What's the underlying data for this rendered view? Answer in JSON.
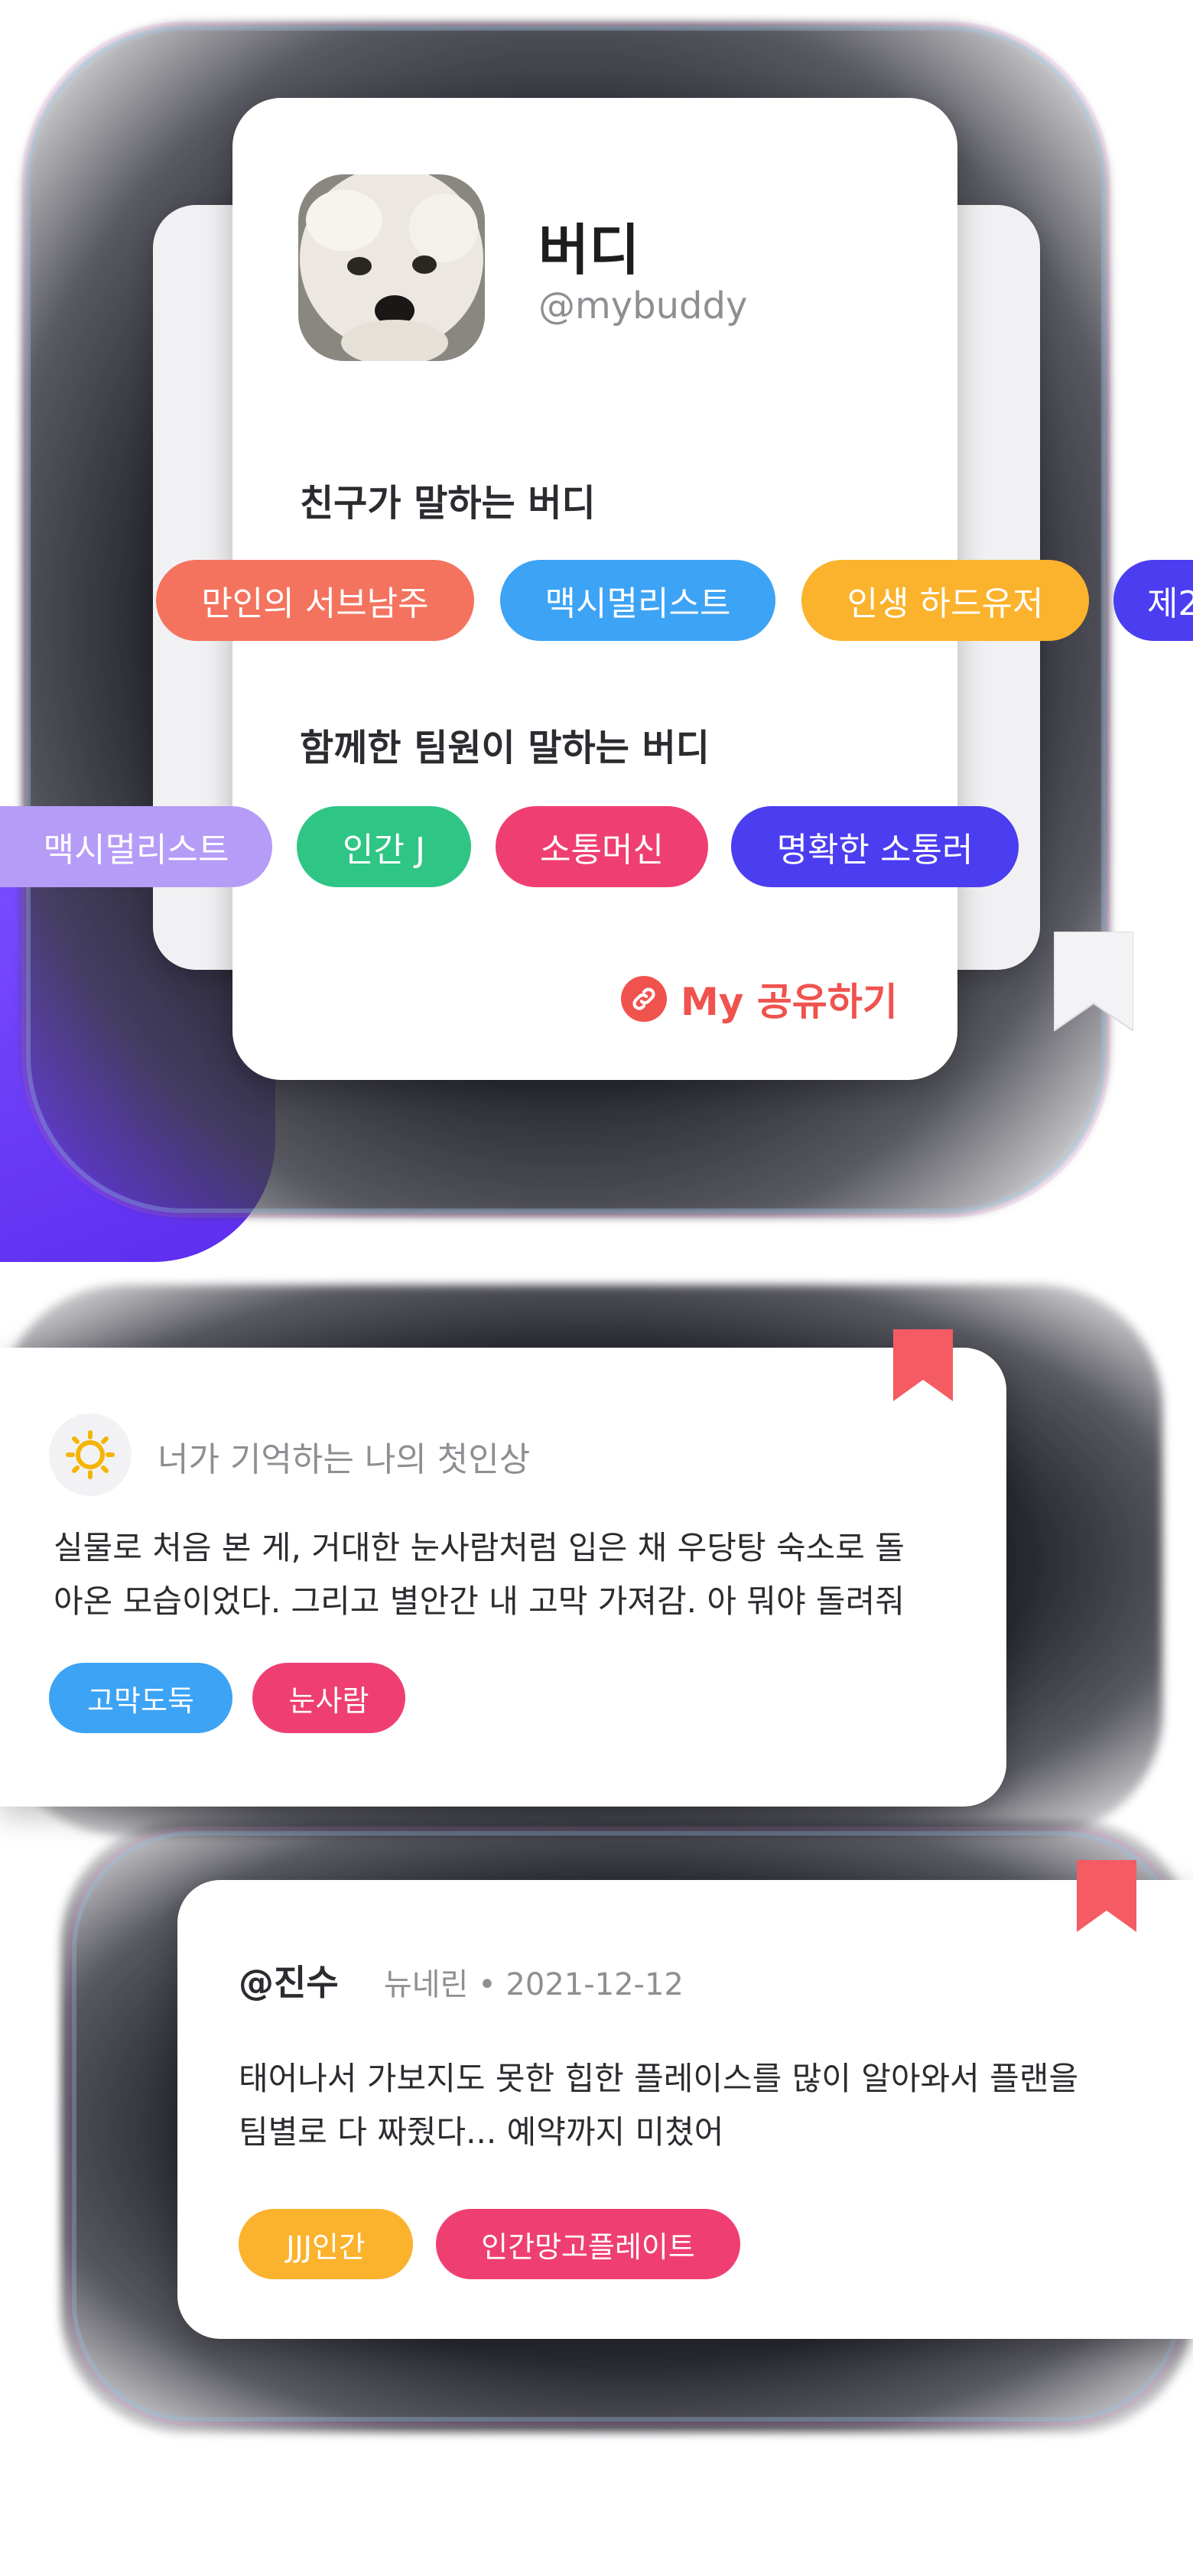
{
  "profile": {
    "name": "버디",
    "handle": "@mybuddy",
    "friends_heading": "친구가 말하는 버디",
    "friends_tags": [
      {
        "label": "만인의 서브남주",
        "color": "#f4735f"
      },
      {
        "label": "맥시멀리스트",
        "color": "#3da3f5"
      },
      {
        "label": "인생 하드유저",
        "color": "#fbb22c"
      },
      {
        "label": "제2",
        "color": "#4b3df0"
      }
    ],
    "team_heading": "함께한 팀원이 말하는 버디",
    "team_tags": [
      {
        "label": "맥시멀리스트",
        "color": "#b59cf7"
      },
      {
        "label": "인간 J",
        "color": "#2fc585"
      },
      {
        "label": "소통머신",
        "color": "#ef3f72"
      },
      {
        "label": "명확한 소통러",
        "color": "#4b3df0"
      }
    ],
    "share_label": "My 공유하기"
  },
  "impression_card": {
    "title": "너가 기억하는 나의 첫인상",
    "text_line1": "실물로 처음 본 게, 거대한 눈사람처럼 입은 채 우당탕 숙소로 돌",
    "text_line2": "아온 모습이었다. 그리고 별안간 내 고막 가져감. 아 뭐야 돌려줘",
    "tags": [
      {
        "label": "고막도둑",
        "color": "#3da3f5"
      },
      {
        "label": "눈사람",
        "color": "#ef3f72"
      }
    ]
  },
  "review_card": {
    "author": "@진수",
    "meta": "뉴네린 • 2021-12-12",
    "text_line1": "태어나서 가보지도 못한 힙한 플레이스를 많이 알아와서 플랜을",
    "text_line2": "팀별로 다 짜줬다... 예약까지 미쳤어",
    "tags": [
      {
        "label": "JJJ인간",
        "color": "#fbb22c"
      },
      {
        "label": "인간망고플레이트",
        "color": "#ef3f72"
      }
    ]
  },
  "colors": {
    "accent_red": "#f0524e",
    "ribbon_red": "#f45b63",
    "purple": "#6b3cf6"
  },
  "icons": {
    "share": "link-icon",
    "bookmark": "bookmark-icon",
    "impression": "sun-icon"
  }
}
